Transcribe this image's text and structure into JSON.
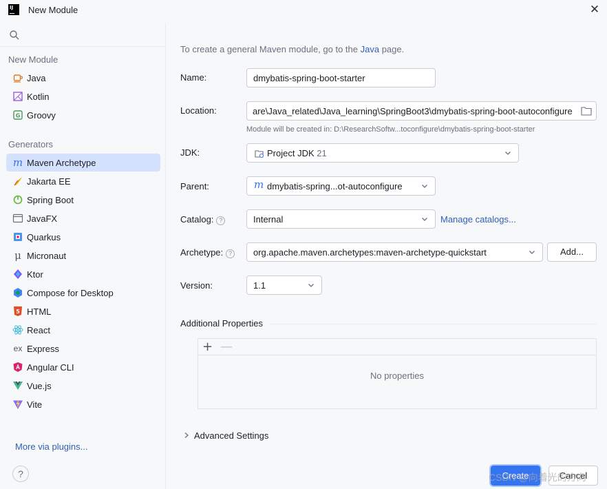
{
  "window": {
    "title": "New Module"
  },
  "sidebar": {
    "search_placeholder": "",
    "group_new_module": "New Module",
    "new_module_items": [
      {
        "label": "Java",
        "icon": "java-cup-icon"
      },
      {
        "label": "Kotlin",
        "icon": "kotlin-icon"
      },
      {
        "label": "Groovy",
        "icon": "groovy-icon"
      }
    ],
    "group_generators": "Generators",
    "generator_items": [
      {
        "label": "Maven Archetype",
        "icon": "maven-icon",
        "selected": true
      },
      {
        "label": "Jakarta EE",
        "icon": "jakarta-icon"
      },
      {
        "label": "Spring Boot",
        "icon": "spring-icon"
      },
      {
        "label": "JavaFX",
        "icon": "javafx-window-icon"
      },
      {
        "label": "Quarkus",
        "icon": "quarkus-icon"
      },
      {
        "label": "Micronaut",
        "icon": "micronaut-icon"
      },
      {
        "label": "Ktor",
        "icon": "ktor-icon"
      },
      {
        "label": "Compose for Desktop",
        "icon": "compose-icon"
      },
      {
        "label": "HTML",
        "icon": "html5-icon"
      },
      {
        "label": "React",
        "icon": "react-icon"
      },
      {
        "label": "Express",
        "icon": "express-icon"
      },
      {
        "label": "Angular CLI",
        "icon": "angular-icon"
      },
      {
        "label": "Vue.js",
        "icon": "vue-icon"
      },
      {
        "label": "Vite",
        "icon": "vite-icon"
      }
    ],
    "more_plugins": "More via plugins...",
    "help": "?"
  },
  "form": {
    "info_prefix": "To create a general Maven module, go to the ",
    "info_link": "Java",
    "info_suffix": " page.",
    "name_label": "Name:",
    "name_value": "dmybatis-spring-boot-starter",
    "location_label": "Location:",
    "location_value": "are\\Java_related\\Java_learning\\SpringBoot3\\dmybatis-spring-boot-autoconfigure",
    "location_hint": "Module will be created in: D:\\ResearchSoftw...toconfigure\\dmybatis-spring-boot-starter",
    "jdk_label": "JDK:",
    "jdk_value": "Project JDK",
    "jdk_version": "21",
    "parent_label": "Parent:",
    "parent_value": "dmybatis-spring...ot-autoconfigure",
    "catalog_label": "Catalog:",
    "catalog_value": "Internal",
    "manage_catalogs": "Manage catalogs...",
    "archetype_label": "Archetype:",
    "archetype_value": "org.apache.maven.archetypes:maven-archetype-quickstart",
    "add_button": "Add...",
    "version_label": "Version:",
    "version_value": "1.1",
    "additional_properties": "Additional Properties",
    "add_property": "+",
    "remove_property": "—",
    "no_properties": "No properties",
    "advanced_settings": "Advanced Settings"
  },
  "footer": {
    "create": "Create",
    "cancel": "Cancel",
    "watermark": "CSDN @向着光的方向"
  },
  "colors": {
    "accent": "#3574f0",
    "selection": "#d4e2ff",
    "link": "#2f5fb3"
  }
}
